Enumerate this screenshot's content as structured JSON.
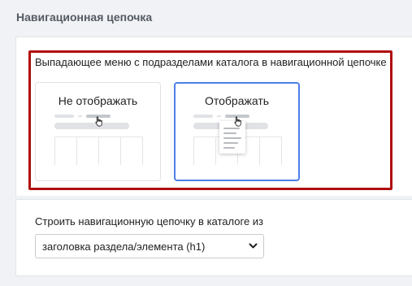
{
  "section": {
    "title": "Навигационная цепочка"
  },
  "dropdown_option": {
    "label": "Выпадающее меню с подразделами каталога в навигационной цепочке",
    "choices": [
      {
        "label": "Не отображать",
        "selected": false
      },
      {
        "label": "Отображать",
        "selected": true
      }
    ]
  },
  "build_option": {
    "label": "Строить навигационную цепочку в каталоге из",
    "select_value": "заголовка раздела/элемента (h1)"
  },
  "colors": {
    "highlight": "#b00d0d",
    "selected_border": "#4d7fe6"
  },
  "icons": {
    "cursor": "hand-pointer-icon",
    "select_arrow": "chevron-down-icon"
  }
}
